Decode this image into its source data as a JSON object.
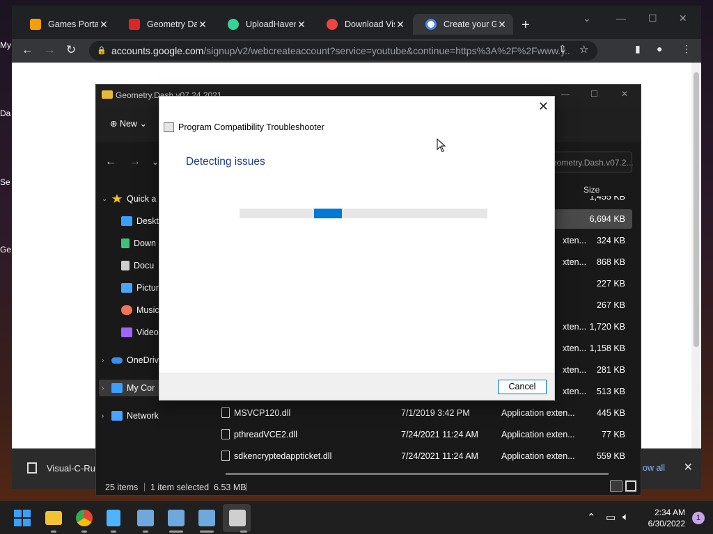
{
  "desktop": {
    "labels": [
      "My",
      "Da",
      "Se",
      "Ge"
    ]
  },
  "chrome": {
    "tabs": [
      {
        "title": "Games Portal",
        "icon": "games-icon",
        "color": "#f59e0b"
      },
      {
        "title": "Geometry Dash",
        "icon": "geometry-dash-icon",
        "color": "#dc2626"
      },
      {
        "title": "UploadHaven",
        "icon": "cloud-upload-icon",
        "color": "#34d399"
      },
      {
        "title": "Download Visu",
        "icon": "power-icon",
        "color": "#ef4444"
      },
      {
        "title": "Create your Go",
        "icon": "google-icon",
        "color": "#ffffff"
      }
    ],
    "active_tab": 4,
    "new_tab": "+",
    "url_domain": "accounts.google.com",
    "url_path": "/signup/v2/webcreateaccount?service=youtube&continue=https%3A%2F%2Fwww.y...",
    "download_bar": {
      "file": "Visual-C-Run",
      "show_all": "ow all"
    }
  },
  "explorer": {
    "title": "Geometry.Dash.v07.24.2021",
    "new_label": "New",
    "search_placeholder": "eometry.Dash.v07.2...",
    "size_header": "Size",
    "sidebar": [
      {
        "label": "Quick a",
        "icon": "star-icon",
        "color": "#f5c518"
      },
      {
        "label": "Deskto",
        "icon": "desktop-icon",
        "color": "#3aa0ff"
      },
      {
        "label": "Down",
        "icon": "download-icon",
        "color": "#3ec27a"
      },
      {
        "label": "Docu",
        "icon": "document-icon",
        "color": "#cfcfcf"
      },
      {
        "label": "Pictur",
        "icon": "pictures-icon",
        "color": "#4aa3ff"
      },
      {
        "label": "Music",
        "icon": "music-icon",
        "color": "#f0735a"
      },
      {
        "label": "Videos",
        "icon": "videos-icon",
        "color": "#a064ff"
      },
      {
        "label": "OneDriv",
        "icon": "onedrive-icon",
        "color": "#3b8fe8"
      },
      {
        "label": "My Cor",
        "icon": "computer-icon",
        "color": "#3aa0ff"
      },
      {
        "label": "Network",
        "icon": "network-icon",
        "color": "#4aa3ff"
      }
    ],
    "rows": [
      {
        "name": "",
        "date": "",
        "type": "",
        "size": "1,455 KB"
      },
      {
        "name": "",
        "date": "",
        "type": "",
        "size": "6,694 KB"
      },
      {
        "name": "",
        "date": "",
        "type": "xten...",
        "size": "324 KB"
      },
      {
        "name": "",
        "date": "",
        "type": "xten...",
        "size": "868 KB"
      },
      {
        "name": "",
        "date": "",
        "type": "",
        "size": "227 KB"
      },
      {
        "name": "",
        "date": "",
        "type": "",
        "size": "267 KB"
      },
      {
        "name": "",
        "date": "",
        "type": "xten...",
        "size": "1,720 KB"
      },
      {
        "name": "",
        "date": "",
        "type": "xten...",
        "size": "1,158 KB"
      },
      {
        "name": "",
        "date": "",
        "type": "xten...",
        "size": "281 KB"
      },
      {
        "name": "",
        "date": "",
        "type": "xten...",
        "size": "513 KB"
      },
      {
        "name": "MSVCP120.dll",
        "date": "7/1/2019 3:42 PM",
        "type": "Application exten...",
        "size": "445 KB"
      },
      {
        "name": "pthreadVCE2.dll",
        "date": "7/24/2021 11:24 AM",
        "type": "Application exten...",
        "size": "77 KB"
      },
      {
        "name": "sdkencryptedappticket.dll",
        "date": "7/24/2021 11:24 AM",
        "type": "Application exten...",
        "size": "559 KB"
      }
    ],
    "status_items": "25 items",
    "status_selected": "1 item selected  6.53 MB"
  },
  "dialog": {
    "window_title": "Program Compatibility Troubleshooter",
    "heading": "Detecting issues",
    "cancel_label": "Cancel",
    "progress_position": 0.3
  },
  "taskbar": {
    "apps": [
      {
        "name": "start-icon",
        "color": "#3aa0ff"
      },
      {
        "name": "file-explorer-icon",
        "color": "#f1c232"
      },
      {
        "name": "chrome-icon",
        "color": "#ea4335"
      },
      {
        "name": "notepad-icon",
        "color": "#4fb3ff"
      },
      {
        "name": "installer-icon",
        "color": "#6fa8dc"
      },
      {
        "name": "installer-icon-2",
        "color": "#6fa8dc"
      },
      {
        "name": "installer-icon-3",
        "color": "#6fa8dc"
      },
      {
        "name": "troubleshooter-icon",
        "color": "#cfcfcf"
      }
    ],
    "time": "2:34 AM",
    "date": "6/30/2022",
    "notifications": "1"
  }
}
